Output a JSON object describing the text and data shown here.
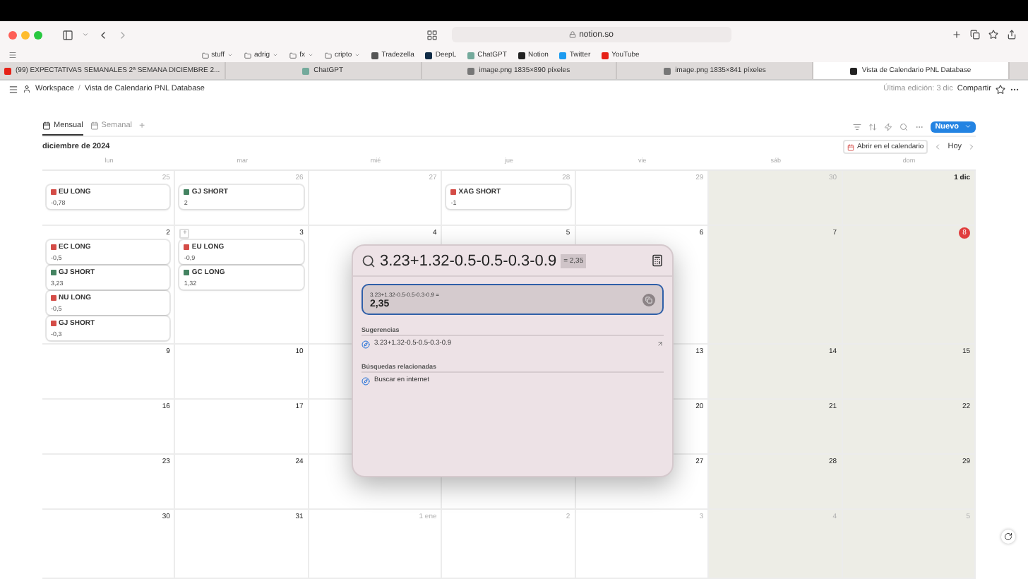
{
  "browser": {
    "address": "notion.so",
    "bookmarks": [
      {
        "label": "stuff",
        "kind": "folder"
      },
      {
        "label": "adrig",
        "kind": "folder"
      },
      {
        "label": "fx",
        "kind": "folder"
      },
      {
        "label": "cripto",
        "kind": "folder"
      },
      {
        "label": "Tradezella",
        "kind": "site",
        "color": "#555555"
      },
      {
        "label": "DeepL",
        "kind": "site",
        "color": "#0f2b46"
      },
      {
        "label": "ChatGPT",
        "kind": "site",
        "color": "#74aa9c"
      },
      {
        "label": "Notion",
        "kind": "site",
        "color": "#222222"
      },
      {
        "label": "Twitter",
        "kind": "site",
        "color": "#1d9bf0"
      },
      {
        "label": "YouTube",
        "kind": "site",
        "color": "#e62117"
      }
    ],
    "tabs": [
      {
        "title": "(99) EXPECTATIVAS SEMANALES 2ª SEMANA DICIEMBRE 2...",
        "selected": false,
        "color": "#e62117"
      },
      {
        "title": "ChatGPT",
        "selected": false,
        "color": "#74aa9c"
      },
      {
        "title": "image.png 1835×890 píxeles",
        "selected": false,
        "color": "#777777"
      },
      {
        "title": "image.png 1835×841 píxeles",
        "selected": false,
        "color": "#777777"
      },
      {
        "title": "Vista de Calendario PNL Database",
        "selected": true,
        "color": "#222222"
      }
    ]
  },
  "topbar": {
    "workspace": "Workspace",
    "separator": "/",
    "page": "Vista de Calendario PNL Database",
    "last_edit": "Última edición: 3 dic",
    "share": "Compartir"
  },
  "views": [
    {
      "label": "Mensual",
      "selected": true
    },
    {
      "label": "Semanal",
      "selected": false
    }
  ],
  "add_view": "+",
  "new_button": "Nuevo",
  "month": "diciembre de 2024",
  "open_calendar": "Abrir en el calendario",
  "today_button": "Hoy",
  "weekdays": [
    {
      "label": "lun",
      "weekend": false
    },
    {
      "label": "mar",
      "weekend": false
    },
    {
      "label": "mié",
      "weekend": false
    },
    {
      "label": "jue",
      "weekend": false
    },
    {
      "label": "vie",
      "weekend": false
    },
    {
      "label": "sáb",
      "weekend": true
    },
    {
      "label": "dom",
      "weekend": true
    }
  ],
  "weeks": [
    [
      {
        "day": "25",
        "muted": true,
        "today": false,
        "events": [
          {
            "title": "EU LONG",
            "value": "-0,78",
            "color": "#d44c47"
          }
        ]
      },
      {
        "day": "26",
        "muted": true,
        "today": false,
        "events": [
          {
            "title": "GJ SHORT",
            "value": "2",
            "color": "#448361"
          }
        ]
      },
      {
        "day": "27",
        "muted": true,
        "today": false
      },
      {
        "day": "28",
        "muted": true,
        "today": false,
        "events": [
          {
            "title": "XAG SHORT",
            "value": "-1",
            "color": "#d44c47"
          }
        ]
      },
      {
        "day": "29",
        "muted": true,
        "today": false
      },
      {
        "day": "30",
        "muted": true,
        "today": false
      },
      {
        "day": "1 dic",
        "muted": false,
        "today": false,
        "bold": true
      }
    ],
    [
      {
        "day": "2",
        "muted": false,
        "today": false,
        "events": [
          {
            "title": "EC LONG",
            "value": "-0,5",
            "color": "#d44c47"
          },
          {
            "title": "GJ SHORT",
            "value": "3,23",
            "color": "#448361"
          },
          {
            "title": "NU LONG",
            "value": "-0,5",
            "color": "#d44c47"
          },
          {
            "title": "GJ SHORT",
            "value": "-0,3",
            "color": "#d44c47"
          }
        ]
      },
      {
        "day": "3",
        "muted": false,
        "today": false,
        "add": "+",
        "events": [
          {
            "title": "EU LONG",
            "value": "-0,9",
            "color": "#d44c47"
          },
          {
            "title": "GC LONG",
            "value": "1,32",
            "color": "#448361"
          }
        ]
      },
      {
        "day": "4",
        "muted": false,
        "today": false
      },
      {
        "day": "5",
        "muted": false,
        "today": false
      },
      {
        "day": "6",
        "muted": false,
        "today": false
      },
      {
        "day": "7",
        "muted": false,
        "today": false
      },
      {
        "day": "8",
        "muted": false,
        "today": true
      }
    ],
    [
      {
        "day": "9",
        "muted": false,
        "today": false
      },
      {
        "day": "10",
        "muted": false,
        "today": false
      },
      {
        "day": "13",
        "muted": false,
        "today": false
      },
      {
        "day": "14",
        "muted": false,
        "today": false
      },
      {
        "day": "15",
        "muted": false,
        "today": false
      }
    ],
    [
      {
        "day": "16",
        "muted": false,
        "today": false
      },
      {
        "day": "17",
        "muted": false,
        "today": false
      },
      {
        "day": "20",
        "muted": false,
        "today": false
      },
      {
        "day": "21",
        "muted": false,
        "today": false
      },
      {
        "day": "22",
        "muted": false,
        "today": false
      }
    ],
    [
      {
        "day": "23",
        "muted": false,
        "today": false
      },
      {
        "day": "24",
        "muted": false,
        "today": false
      },
      {
        "day": "27",
        "muted": false,
        "today": false
      },
      {
        "day": "28",
        "muted": false,
        "today": false
      },
      {
        "day": "29",
        "muted": false,
        "today": false
      }
    ],
    [
      {
        "day": "30",
        "muted": false,
        "today": false
      },
      {
        "day": "31",
        "muted": false,
        "today": false
      },
      {
        "day": "1 ene",
        "muted": true,
        "today": false
      },
      {
        "day": "2",
        "muted": true,
        "today": false
      },
      {
        "day": "3",
        "muted": true,
        "today": false
      },
      {
        "day": "4",
        "muted": true,
        "today": false
      },
      {
        "day": "5",
        "muted": true,
        "today": false
      }
    ]
  ],
  "spotlight": {
    "query": "3.23+1.32-0.5-0.5-0.3-0.9",
    "inline_result": "= 2,35",
    "result_expression": "3.23+1.32-0.5-0.5-0.3-0.9 =",
    "result_value": "2,35",
    "sections": [
      {
        "title": "Sugerencias",
        "items": [
          {
            "label": "3.23+1.32-0.5-0.5-0.3-0.9",
            "kind": "suggestion"
          }
        ]
      },
      {
        "title": "Búsquedas relacionadas",
        "items": [
          {
            "label": "Buscar en internet",
            "kind": "web"
          }
        ]
      }
    ]
  }
}
